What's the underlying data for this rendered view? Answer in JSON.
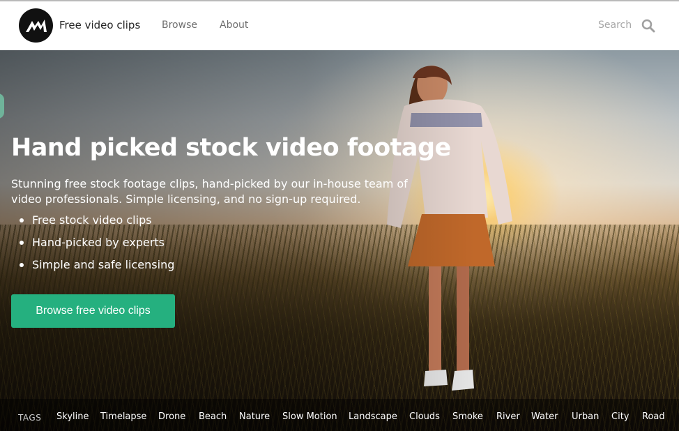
{
  "header": {
    "brand": "Free video clips",
    "nav": [
      {
        "label": "Browse"
      },
      {
        "label": "About"
      }
    ],
    "search_label": "Search"
  },
  "hero": {
    "title": "Hand picked stock video footage",
    "subtitle": "Stunning free stock footage clips, hand-picked by our in-house team of video professionals. Simple licensing, and no sign-up required.",
    "features": [
      "Free stock video clips",
      "Hand-picked by experts",
      "Simple and safe licensing"
    ],
    "cta_label": "Browse free video clips"
  },
  "tags": {
    "label": "TAGS",
    "items": [
      "Skyline",
      "Timelapse",
      "Drone",
      "Beach",
      "Nature",
      "Slow Motion",
      "Landscape",
      "Clouds",
      "Smoke",
      "River",
      "Water",
      "Urban",
      "City",
      "Road"
    ]
  },
  "colors": {
    "accent": "#25b07f",
    "logo_bg": "#111111",
    "header_bg": "#ffffff"
  }
}
